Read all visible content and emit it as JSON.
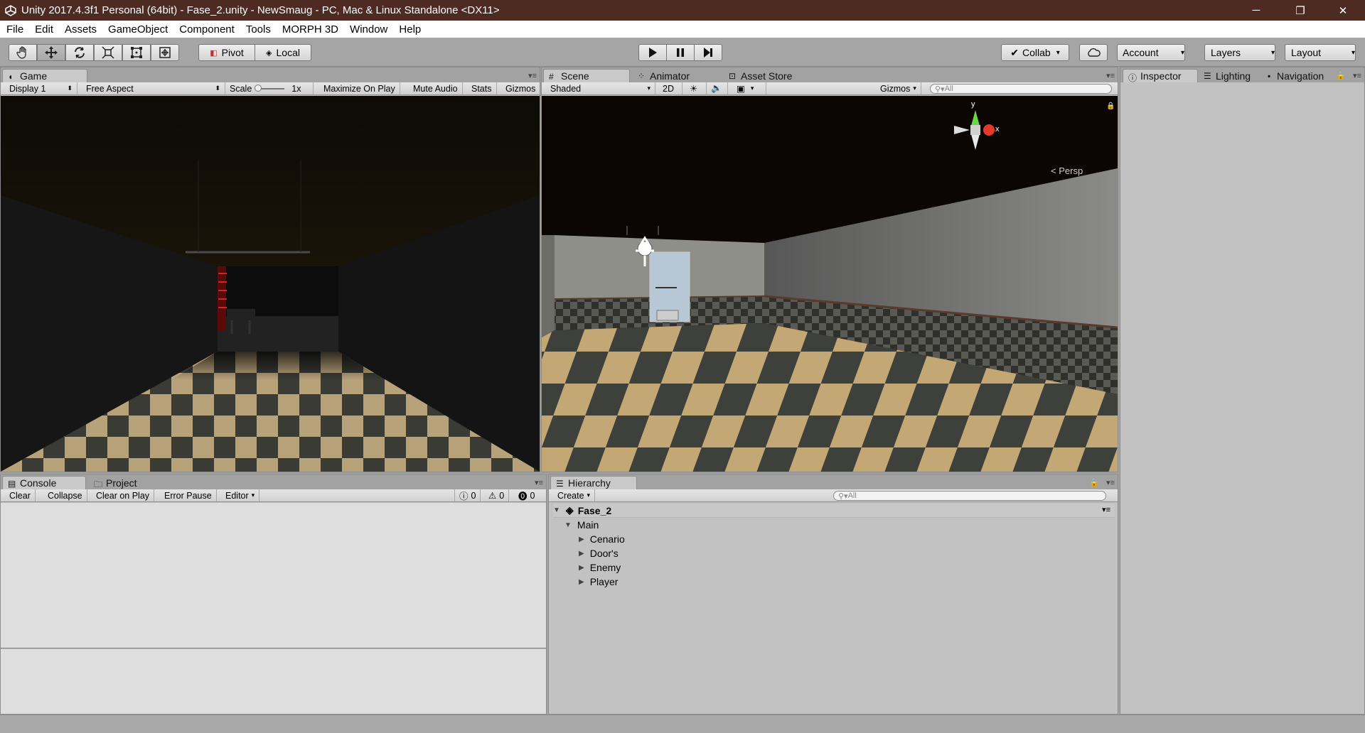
{
  "window": {
    "title": "Unity 2017.4.3f1 Personal (64bit) - Fase_2.unity - NewSmaug - PC, Mac & Linux Standalone <DX11>",
    "minimize": "─",
    "maximize": "❐",
    "close": "✕"
  },
  "menu": [
    "File",
    "Edit",
    "Assets",
    "GameObject",
    "Component",
    "Tools",
    "MORPH 3D",
    "Window",
    "Help"
  ],
  "toolbar": {
    "pivot": "Pivot",
    "local": "Local",
    "collab": "Collab",
    "account": "Account",
    "layers": "Layers",
    "layout": "Layout"
  },
  "game": {
    "tab": "Game",
    "display": "Display 1",
    "aspect": "Free Aspect",
    "scale_label": "Scale",
    "scale_value": "1x",
    "maximize": "Maximize On Play",
    "mute": "Mute Audio",
    "stats": "Stats",
    "gizmos": "Gizmos"
  },
  "scene": {
    "tabs": [
      "Scene",
      "Animator",
      "Asset Store"
    ],
    "shading": "Shaded",
    "mode2d": "2D",
    "gizmos": "Gizmos",
    "search_placeholder": "All",
    "gizmo_y": "y",
    "gizmo_x": "x",
    "persp": "Persp"
  },
  "inspector": {
    "tabs": [
      "Inspector",
      "Lighting",
      "Navigation"
    ]
  },
  "console": {
    "tabs": [
      "Console",
      "Project"
    ],
    "buttons": [
      "Clear",
      "Collapse",
      "Clear on Play",
      "Error Pause",
      "Editor"
    ],
    "info_count": "0",
    "warn_count": "0",
    "error_count": "0"
  },
  "hierarchy": {
    "tab": "Hierarchy",
    "create": "Create",
    "search_placeholder": "All",
    "scene": "Fase_2",
    "root": "Main",
    "children": [
      "Cenario",
      "Door's",
      "Enemy",
      "Player"
    ]
  },
  "colors": {
    "titlebar": "#4d2a22",
    "panel_bg": "#c2c2c2",
    "toolbar_bg": "#a5a5a5"
  }
}
